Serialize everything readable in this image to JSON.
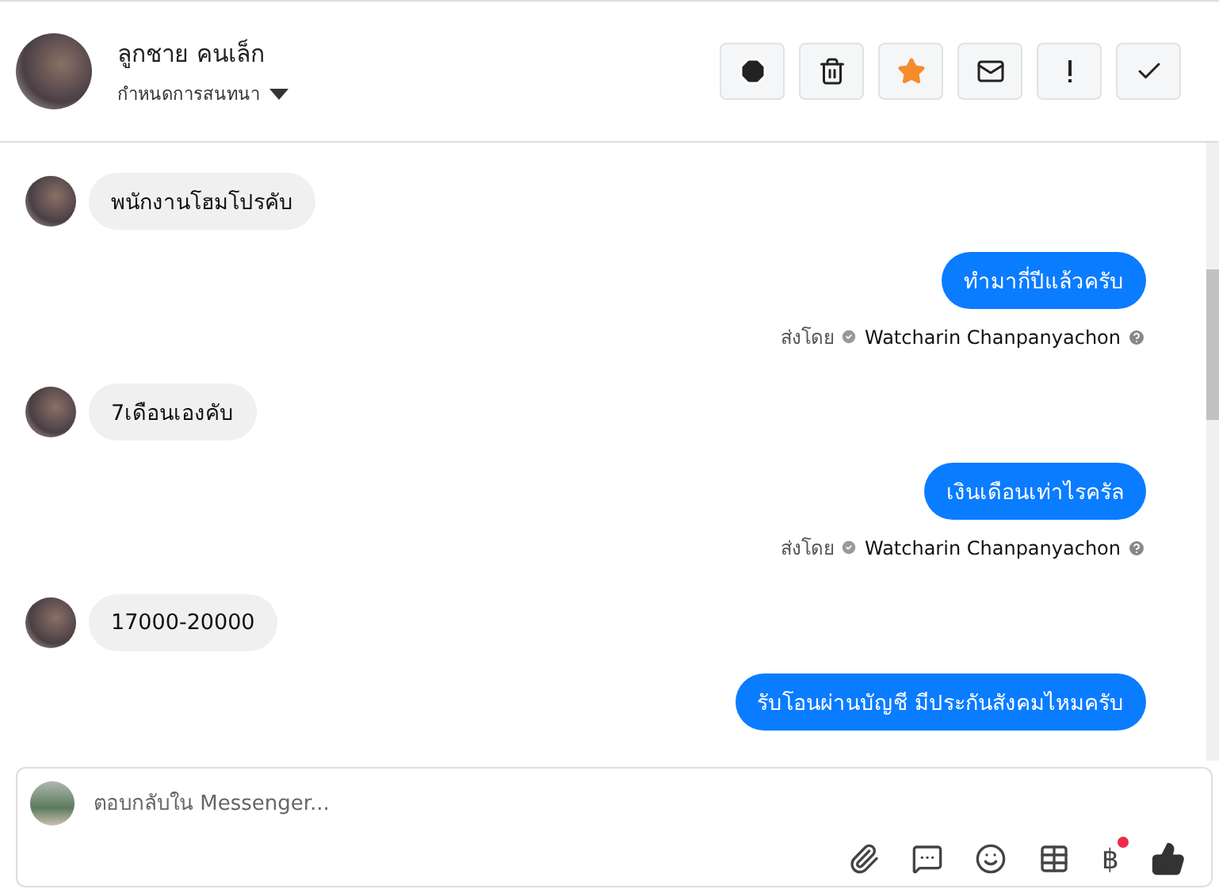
{
  "header": {
    "name": "ลูกชาย คนเล็ก",
    "subtitle": "กำหนดการสนทนา"
  },
  "actions": [
    {
      "kind": "spam",
      "active": false
    },
    {
      "kind": "trash",
      "active": false
    },
    {
      "kind": "star",
      "active": true
    },
    {
      "kind": "unread",
      "active": false
    },
    {
      "kind": "important",
      "active": false
    },
    {
      "kind": "done",
      "active": false
    }
  ],
  "messages": [
    {
      "kind": "incoming",
      "text": "พนักงานโฮมโปรคับ"
    },
    {
      "kind": "outgoing",
      "text": "ทำมากี่ปีแล้วครับ",
      "sent_by_label": "ส่งโดย",
      "sender": "Watcharin Chanpanyachon"
    },
    {
      "kind": "incoming",
      "text": "7เดือนเองคับ"
    },
    {
      "kind": "outgoing",
      "text": "เงินเดือนเท่าไรครัล",
      "sent_by_label": "ส่งโดย",
      "sender": "Watcharin Chanpanyachon"
    },
    {
      "kind": "incoming",
      "text": "17000-20000"
    },
    {
      "kind": "outgoing",
      "text": "รับโอนผ่านบัญชี มีประกันสังคมไหมครับ"
    }
  ],
  "composer": {
    "placeholder": "ตอบกลับใน Messenger...",
    "payment_symbol": "฿",
    "payment_notification": true
  }
}
